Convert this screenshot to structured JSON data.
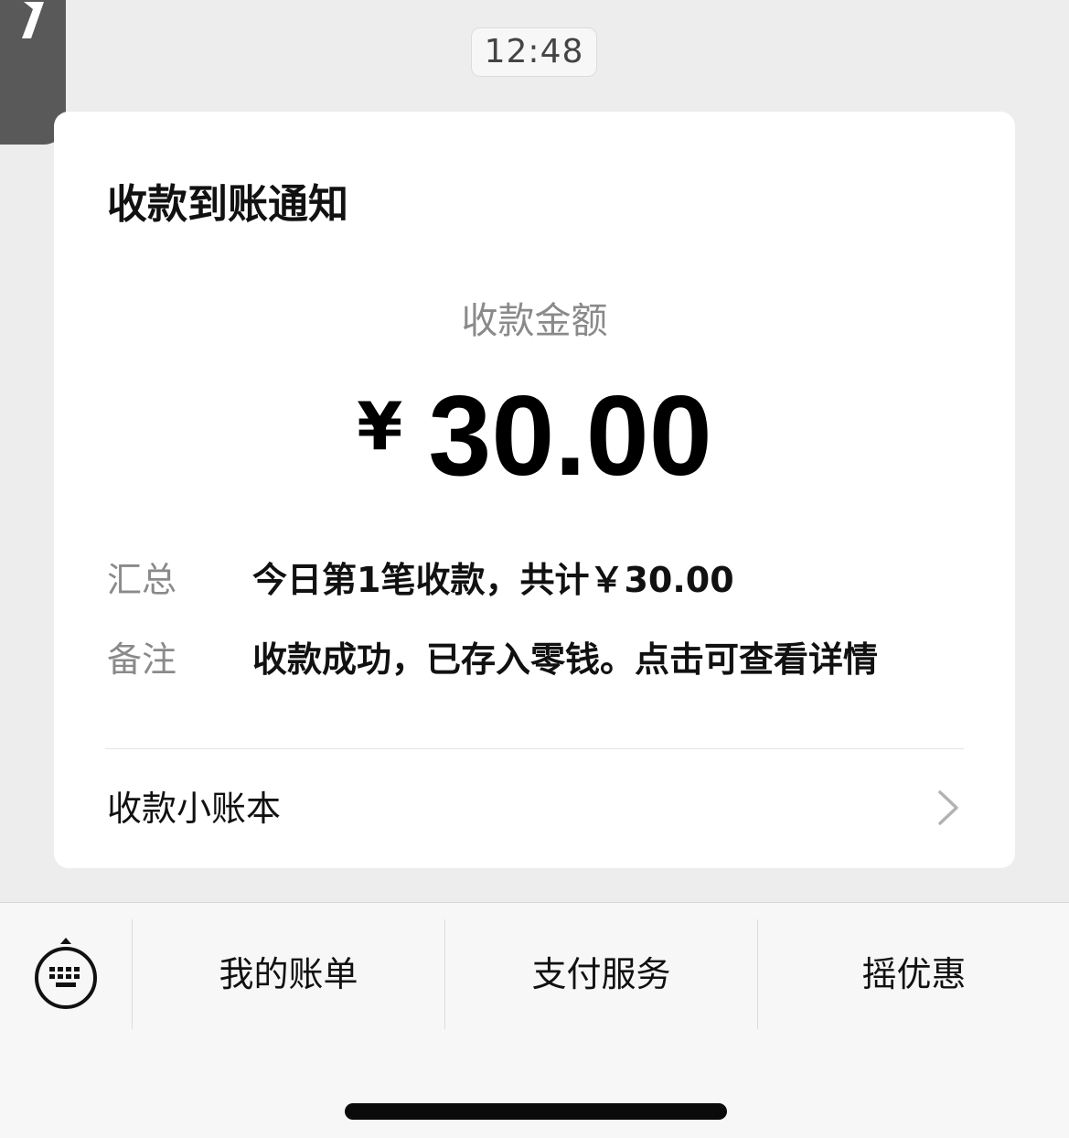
{
  "header": {
    "time": "12:48"
  },
  "card": {
    "title": "收款到账通知",
    "amount_label": "收款金额",
    "currency_symbol": "¥",
    "amount_value": "30.00",
    "summary": {
      "key": "汇总",
      "value": "今日第1笔收款，共计￥30.00"
    },
    "remark": {
      "key": "备注",
      "value": "收款成功，已存入零钱。点击可查看详情"
    },
    "ledger_link_label": "收款小账本"
  },
  "bottom_menu": {
    "items": [
      {
        "label": "我的账单"
      },
      {
        "label": "支付服务"
      },
      {
        "label": "摇优惠"
      }
    ]
  },
  "icons": {
    "back": "back-chevron-icon",
    "keyboard": "keyboard-icon",
    "link": "chevron-right-icon"
  },
  "colors": {
    "background": "#ededed",
    "card": "#ffffff",
    "muted_text": "#8a8a8a",
    "primary_text": "#111111"
  }
}
